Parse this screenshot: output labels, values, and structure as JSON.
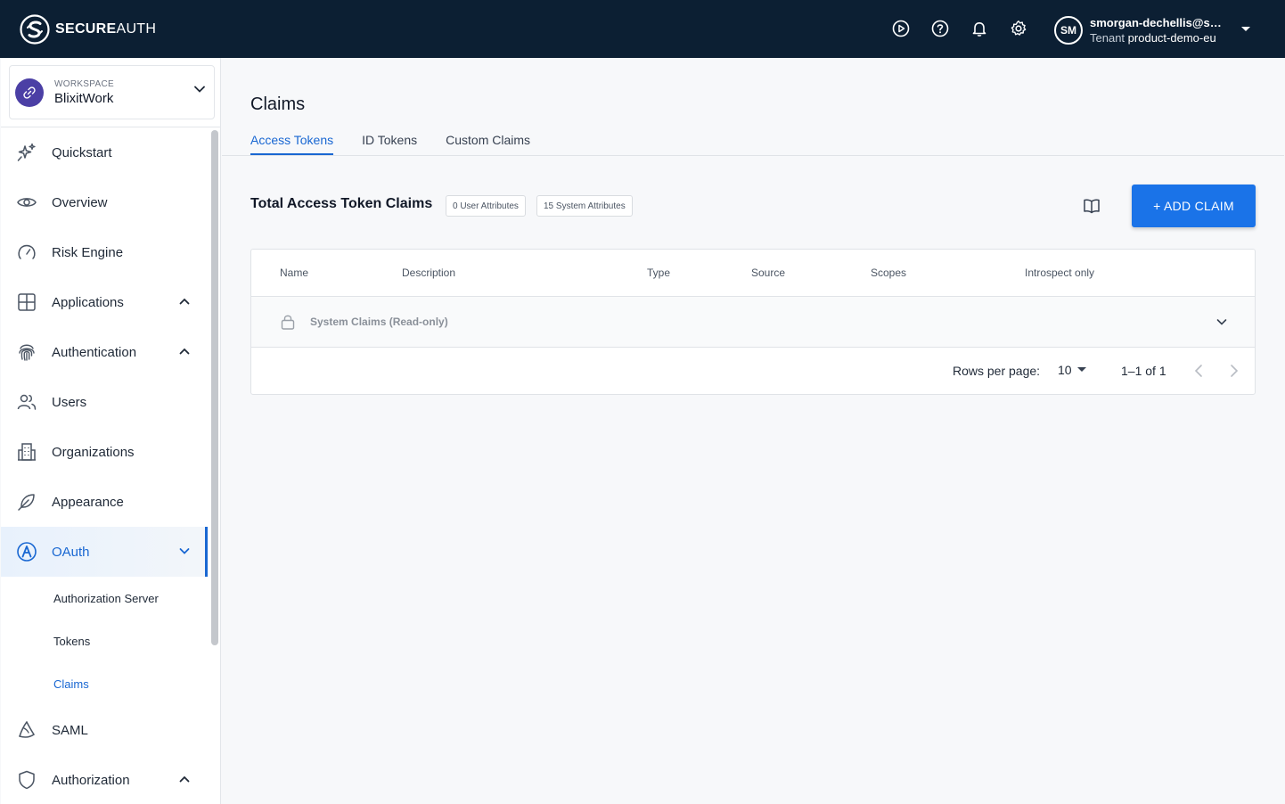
{
  "brand": {
    "name_bold": "SECURE",
    "name_light": "AUTH"
  },
  "header": {
    "icons": [
      "play-circle-icon",
      "help-icon",
      "bell-icon",
      "gear-icon"
    ],
    "user": {
      "initials": "SM",
      "email": "smorgan-dechellis@se...",
      "tenant_label": "Tenant",
      "tenant_name": "product-demo-eu"
    }
  },
  "workspace": {
    "label": "WORKSPACE",
    "name": "BlixitWork"
  },
  "sidebar": {
    "items": [
      {
        "label": "Quickstart",
        "icon": "sparkle-icon"
      },
      {
        "label": "Overview",
        "icon": "eye-icon"
      },
      {
        "label": "Risk Engine",
        "icon": "gauge-icon"
      },
      {
        "label": "Applications",
        "icon": "grid-icon",
        "caret": "up"
      },
      {
        "label": "Authentication",
        "icon": "fingerprint-icon",
        "caret": "up"
      },
      {
        "label": "Users",
        "icon": "users-icon"
      },
      {
        "label": "Organizations",
        "icon": "building-icon"
      },
      {
        "label": "Appearance",
        "icon": "feather-icon"
      },
      {
        "label": "OAuth",
        "icon": "oauth-icon",
        "caret": "down",
        "active": true
      },
      {
        "label": "SAML",
        "icon": "saml-icon"
      },
      {
        "label": "Authorization",
        "icon": "shield-icon",
        "caret": "up"
      }
    ],
    "oauth_subitems": [
      {
        "label": "Authorization Server"
      },
      {
        "label": "Tokens"
      },
      {
        "label": "Claims",
        "active": true
      }
    ]
  },
  "main": {
    "title": "Claims",
    "tabs": [
      {
        "label": "Access Tokens",
        "active": true
      },
      {
        "label": "ID Tokens"
      },
      {
        "label": "Custom Claims"
      }
    ],
    "section_title": "Total Access Token Claims",
    "badges": [
      "0 User Attributes",
      "15 System Attributes"
    ],
    "add_button": "+ ADD CLAIM",
    "table": {
      "columns": [
        "Name",
        "Description",
        "Type",
        "Source",
        "Scopes",
        "Introspect only"
      ],
      "group_row": "System Claims (Read-only)"
    },
    "pagination": {
      "rows_per_page_label": "Rows per page:",
      "rows_per_page": "10",
      "range": "1–1 of 1"
    }
  },
  "colors": {
    "topbar": "#0c1f33",
    "primary": "#1a73e8",
    "active_text": "#1967d2"
  }
}
